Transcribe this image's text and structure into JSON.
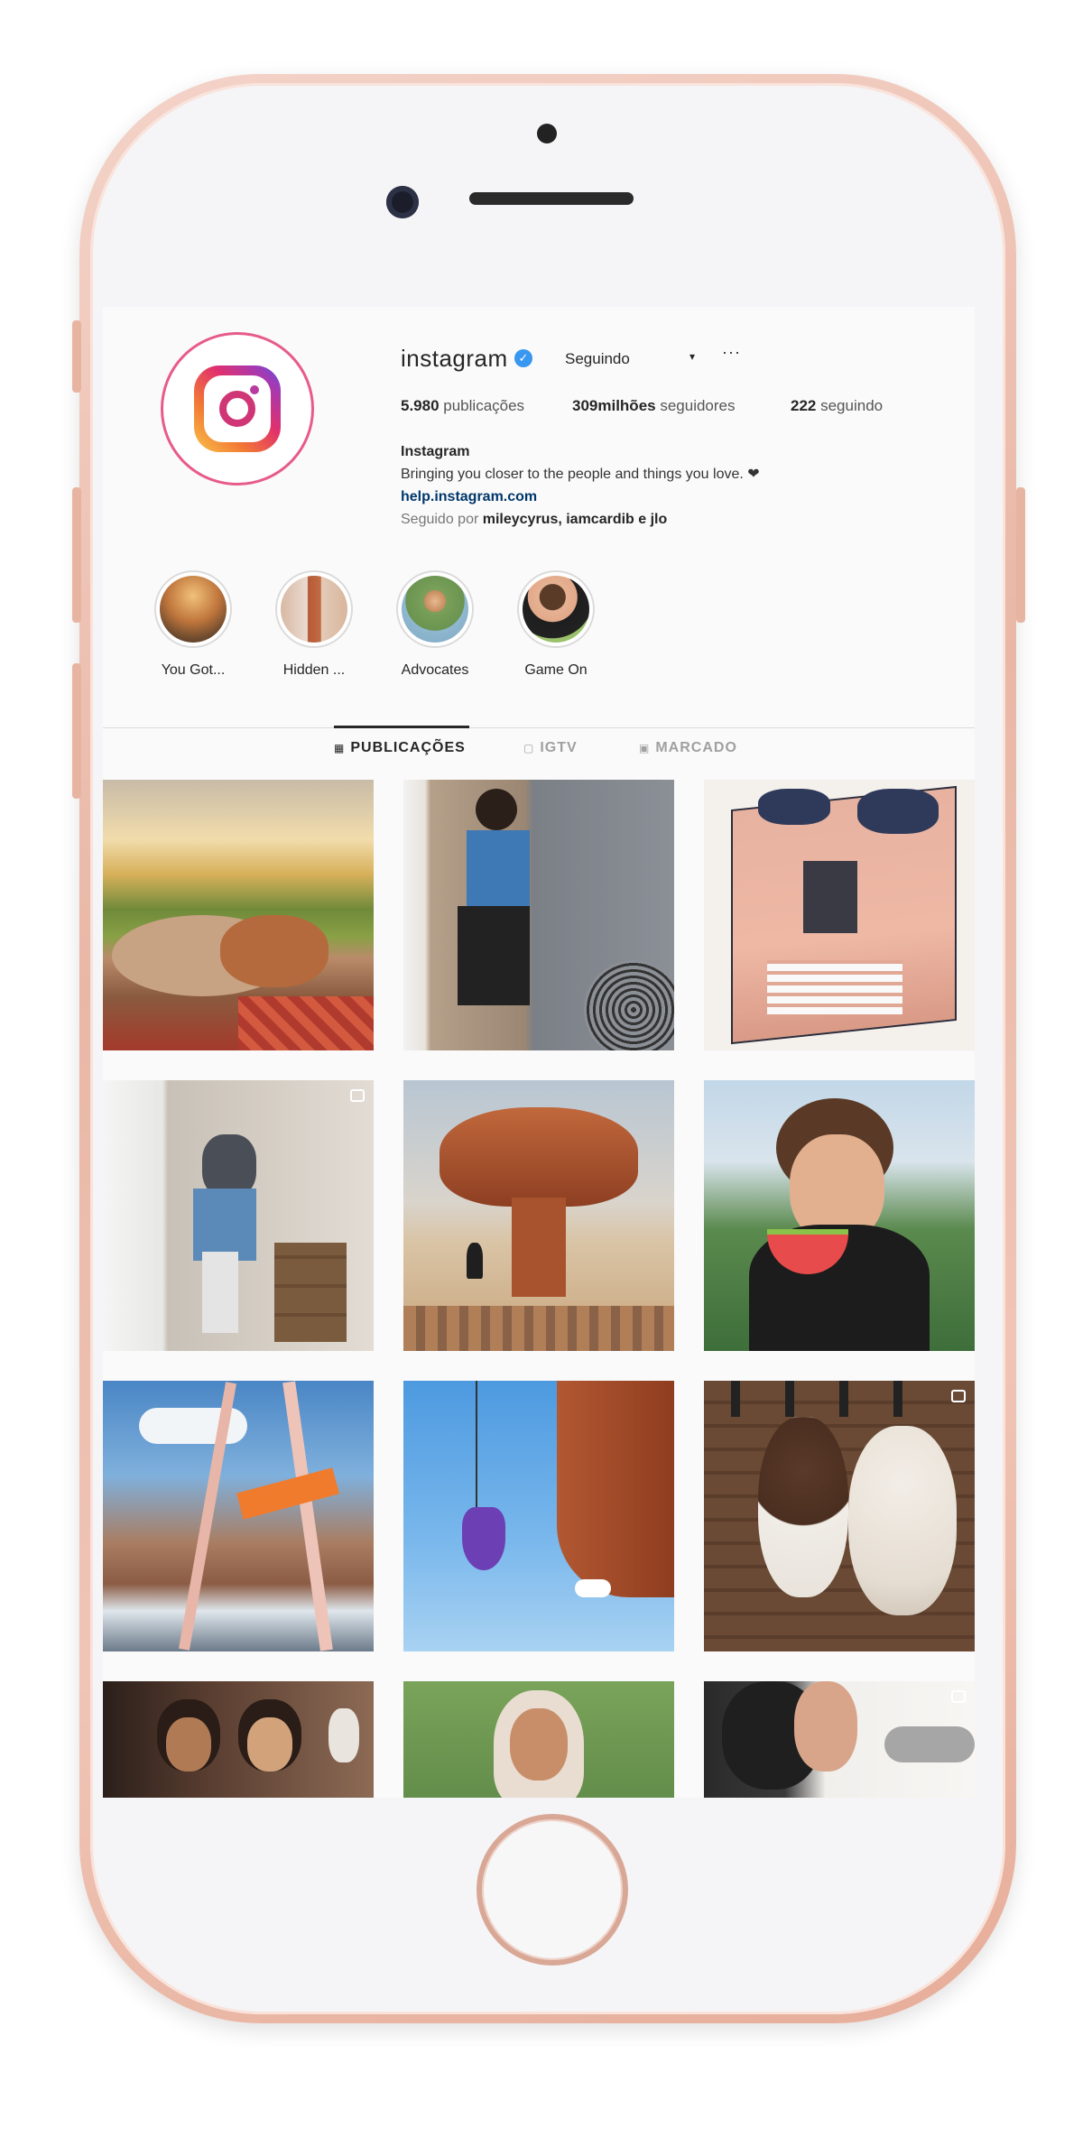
{
  "profile": {
    "username": "instagram",
    "verified_mark": "✓",
    "follow_button": "Seguindo",
    "caret": "▾",
    "more": "···",
    "stats": [
      {
        "value": "5.980",
        "label": " publicações"
      },
      {
        "value": "309milhões",
        "label": " seguidores"
      },
      {
        "value": "222",
        "label": " seguindo"
      }
    ],
    "name": "Instagram",
    "bio": "Bringing you closer to the people and things you love. ❤",
    "link": "help.instagram.com",
    "followed_prefix": "Seguido por ",
    "followed_names": "mileycyrus, iamcardib e jlo"
  },
  "highlights": [
    {
      "label": "You Got..."
    },
    {
      "label": "Hidden ..."
    },
    {
      "label": "Advocates"
    },
    {
      "label": "Game On"
    }
  ],
  "tabs": [
    {
      "icon": "▦",
      "label": "PUBLICAÇÕES"
    },
    {
      "icon": "▢",
      "label": "IGTV"
    },
    {
      "icon": "▣",
      "label": "MARCADO"
    }
  ],
  "colors": {
    "accent": "#3897f0",
    "text": "#262626",
    "link": "#00376b"
  }
}
